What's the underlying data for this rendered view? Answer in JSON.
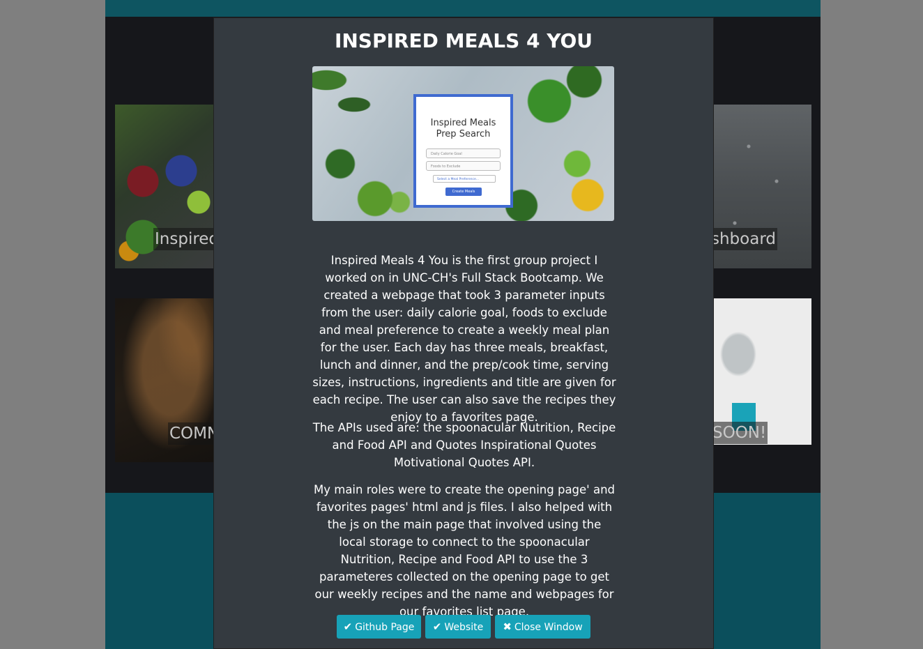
{
  "background_cards": [
    {
      "label": "Inspired"
    },
    {
      "label": "shboard"
    },
    {
      "label": "COMN"
    },
    {
      "label": "SOON!"
    }
  ],
  "modal": {
    "title": "INSPIRED MEALS 4 YOU",
    "preview": {
      "title_line1": "Inspired Meals",
      "title_line2": "Prep Search",
      "field1": "Daily Calorie Goal",
      "field2": "Foods to Exclude",
      "select": "Select a Meal Preference...",
      "button": "Create Meals"
    },
    "paragraph1": "Inspired Meals 4 You is the first group project I worked on in UNC-CH's Full Stack Bootcamp. We created a webpage that took 3 parameter inputs from the user: daily calorie goal, foods to exclude and meal preference to create a weekly meal plan for the user. Each day has three meals, breakfast, lunch and dinner, and the prep/cook time, serving sizes, instructions, ingredients and title are given for each recipe. The user can also save the recipes they enjoy to a favorites page.",
    "paragraph2": "The APIs used are: the spoonacular Nutrition, Recipe and Food API and Quotes Inspirational Quotes Motivational Quotes API.",
    "paragraph3": "My main roles were to create the opening page' and favorites pages' html and js files. I also helped with the js on the main page that involved using the local storage to connect to the spoonacular Nutrition, Recipe and Food API to use the 3 parameteres collected on the opening page to get our weekly recipes and the name and webpages for our favorites list page.",
    "buttons": {
      "github": "Github Page",
      "website": "Website",
      "close": "Close Window"
    },
    "icons": {
      "github": "check-icon",
      "website": "check-icon",
      "close": "close-icon"
    }
  },
  "colors": {
    "modal_bg": "#343a40",
    "button": "#17a2b8",
    "page_teal": "#0b4f5c",
    "overlay": "#7f7f7f"
  }
}
